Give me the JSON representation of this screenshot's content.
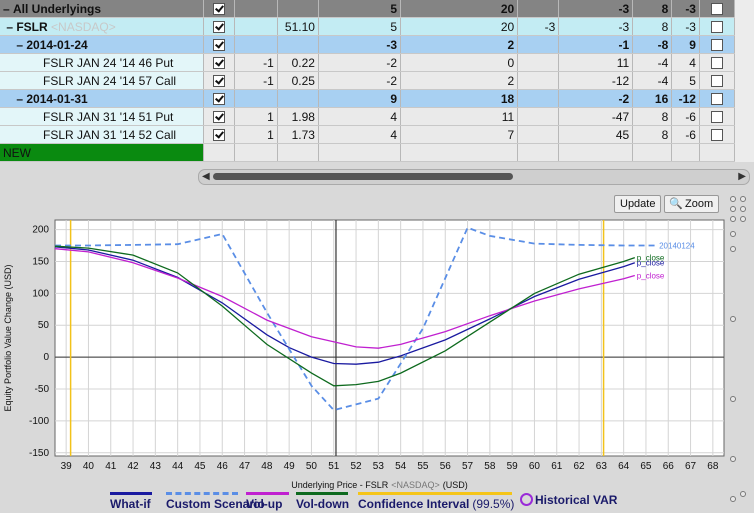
{
  "grid": {
    "rows": [
      {
        "kind": "all",
        "name": "All Underlyings",
        "sec": "",
        "checked": true,
        "qty": "",
        "price": "",
        "c1": "5",
        "c2": "20",
        "c3": "",
        "c4": "-3",
        "c5": "8",
        "c6": "-3"
      },
      {
        "kind": "und",
        "name": "FSLR",
        "sec": "<NASDAQ>",
        "checked": true,
        "qty": "",
        "price": "51.10",
        "c1": "5",
        "c2": "20",
        "c3": "-3",
        "c4": "-3",
        "c5": "8",
        "c6": "-3"
      },
      {
        "kind": "exp",
        "name": "2014-01-24",
        "sec": "",
        "checked": true,
        "qty": "",
        "price": "",
        "c1": "-3",
        "c2": "2",
        "c3": "",
        "c4": "-1",
        "c5": "-8",
        "c6": "9"
      },
      {
        "kind": "pos",
        "name": "FSLR JAN 24 '14 46 Put",
        "sec": "",
        "checked": true,
        "qty": "-1",
        "price": "0.22",
        "c1": "-2",
        "c2": "0",
        "c3": "",
        "c4": "11",
        "c5": "-4",
        "c6": "4"
      },
      {
        "kind": "pos",
        "name": "FSLR JAN 24 '14 57 Call",
        "sec": "",
        "checked": true,
        "qty": "-1",
        "price": "0.25",
        "c1": "-2",
        "c2": "2",
        "c3": "",
        "c4": "-12",
        "c5": "-4",
        "c6": "5"
      },
      {
        "kind": "exp",
        "name": "2014-01-31",
        "sec": "",
        "checked": true,
        "qty": "",
        "price": "",
        "c1": "9",
        "c2": "18",
        "c3": "",
        "c4": "-2",
        "c5": "16",
        "c6": "-12"
      },
      {
        "kind": "pos",
        "name": "FSLR JAN 31 '14 51 Put",
        "sec": "",
        "checked": true,
        "qty": "1",
        "price": "1.98",
        "c1": "4",
        "c2": "11",
        "c3": "",
        "c4": "-47",
        "c5": "8",
        "c6": "-6"
      },
      {
        "kind": "pos",
        "name": "FSLR JAN 31 '14 52 Call",
        "sec": "",
        "checked": true,
        "qty": "1",
        "price": "1.73",
        "c1": "4",
        "c2": "7",
        "c3": "",
        "c4": "45",
        "c5": "8",
        "c6": "-6"
      },
      {
        "kind": "new",
        "name": "NEW",
        "sec": "",
        "checked": false,
        "qty": "",
        "price": "",
        "c1": "",
        "c2": "",
        "c3": "",
        "c4": "",
        "c5": "",
        "c6": ""
      }
    ]
  },
  "toolbar": {
    "update_label": "Update",
    "zoom_label": "Zoom"
  },
  "chart_data": {
    "type": "line",
    "ylabel": "Equity Portfolio Value Change (USD)",
    "xlabel_prefix": "Underlying Price - FSLR",
    "xlabel_exchange": "<NASDAQ>",
    "xlabel_unit": "(USD)",
    "xlim": [
      38.5,
      68.5
    ],
    "ylim": [
      -155,
      215
    ],
    "xticks": [
      39,
      40,
      41,
      42,
      43,
      44,
      45,
      46,
      47,
      48,
      49,
      50,
      51,
      52,
      53,
      54,
      55,
      56,
      57,
      58,
      59,
      60,
      61,
      62,
      63,
      64,
      65,
      66,
      67,
      68
    ],
    "yticks": [
      200,
      150,
      100,
      50,
      0,
      -50,
      -100,
      -150
    ],
    "current_price": 51.1,
    "confidence_interval": [
      39.2,
      63.1
    ],
    "series": [
      {
        "name": "What-if",
        "color": "#1a1aa0",
        "dash": false,
        "x": [
          38.5,
          40,
          42,
          44,
          46,
          48,
          49,
          50,
          51,
          52,
          53,
          54,
          56,
          58,
          60,
          62,
          64,
          64.5
        ],
        "y": [
          173,
          168,
          152,
          125,
          85,
          35,
          15,
          0,
          -10,
          -11,
          -8,
          2,
          27,
          60,
          95,
          122,
          142,
          148
        ],
        "label": "p_close"
      },
      {
        "name": "Custom Scenario",
        "color": "#5a8ee6",
        "dash": true,
        "x": [
          38.5,
          40,
          42,
          44,
          46,
          48,
          50,
          51,
          53,
          55,
          57,
          58,
          60,
          62,
          64,
          65.5
        ],
        "y": [
          175,
          175,
          176,
          177,
          193,
          70,
          -45,
          -83,
          -65,
          45,
          203,
          190,
          178,
          176,
          175,
          175
        ],
        "label": "20140124"
      },
      {
        "name": "Vol-up",
        "color": "#c020d0",
        "dash": false,
        "x": [
          38.5,
          40,
          42,
          44,
          46,
          48,
          50,
          52,
          53,
          54,
          56,
          58,
          60,
          62,
          64,
          64.5
        ],
        "y": [
          170,
          165,
          148,
          124,
          95,
          58,
          32,
          16,
          14,
          20,
          40,
          65,
          88,
          107,
          123,
          128
        ],
        "label": "p_close"
      },
      {
        "name": "Vol-down",
        "color": "#0e6a1e",
        "dash": false,
        "x": [
          38.5,
          40,
          42,
          44,
          46,
          48,
          50,
          51,
          52,
          53,
          54,
          56,
          58,
          60,
          62,
          64,
          64.5
        ],
        "y": [
          174,
          171,
          160,
          132,
          80,
          20,
          -25,
          -45,
          -43,
          -38,
          -25,
          10,
          55,
          100,
          130,
          150,
          156
        ],
        "label": "p_close"
      }
    ]
  },
  "legend": {
    "items": [
      {
        "label": "What-if",
        "color": "#1a1aa0"
      },
      {
        "label": "Custom Scenario",
        "color": "#5a8ee6"
      },
      {
        "label": "Vol-up",
        "color": "#c020d0"
      },
      {
        "label": "Vol-down",
        "color": "#0e6a1e"
      },
      {
        "label": "Confidence Interval",
        "suffix": "(99.5%)",
        "color": "#f5c518"
      }
    ],
    "historical_var": "Historical VAR",
    "var_color": "#9a2bd8"
  }
}
